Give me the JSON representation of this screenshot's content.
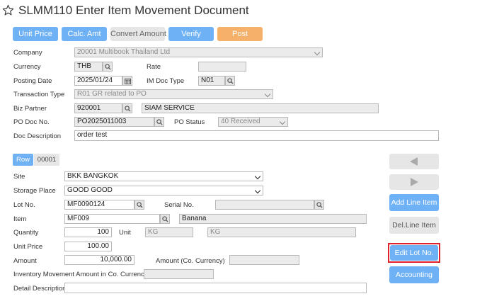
{
  "header": {
    "title": "SLMM110 Enter Item Movement Document"
  },
  "toolbar": {
    "unit_price": "Unit Price",
    "calc_amt": "Calc. Amt",
    "convert_amount": "Convert Amount",
    "verify": "Verify",
    "post": "Post"
  },
  "header_form": {
    "company_label": "Company",
    "company_value": "20001 Multibook Thailand Ltd",
    "currency_label": "Currency",
    "currency_value": "THB",
    "rate_label": "Rate",
    "rate_value": "",
    "posting_date_label": "Posting Date",
    "posting_date_value": "2025/01/24",
    "im_doc_type_label": "IM Doc Type",
    "im_doc_type_value": "N01",
    "transaction_type_label": "Transaction Type",
    "transaction_type_value": "R01 GR related to PO",
    "biz_partner_label": "Biz Partner",
    "biz_partner_code": "920001",
    "biz_partner_name": "SIAM SERVICE",
    "po_doc_no_label": "PO Doc No.",
    "po_doc_no_value": "PO2025011003",
    "po_status_label": "PO Status",
    "po_status_value": "40 Received",
    "doc_description_label": "Doc Description",
    "doc_description_value": "order test"
  },
  "row_tabs": {
    "row_label": "Row",
    "row_number": "00001"
  },
  "line_form": {
    "site_label": "Site",
    "site_value": "BKK BANGKOK",
    "storage_place_label": "Storage Place",
    "storage_place_value": "GOOD GOOD",
    "lot_no_label": "Lot No.",
    "lot_no_value": "MF0090124",
    "serial_no_label": "Serial No.",
    "serial_no_value": "",
    "item_label": "Item",
    "item_code": "MF009",
    "item_name": "Banana",
    "quantity_label": "Quantity",
    "quantity_value": "100",
    "unit_label": "Unit",
    "unit_code": "KG",
    "unit_name": "KG",
    "unit_price_label": "Unit Price",
    "unit_price_value": "100.00",
    "amount_label": "Amount",
    "amount_value": "10,000.00",
    "amount_co_label": "Amount (Co. Currency)",
    "amount_co_value": "",
    "inv_mvmt_label": "Inventory Movement Amount in Co. Currency",
    "inv_mvmt_value": "",
    "detail_desc_label": "Detail Description",
    "detail_desc_value": ""
  },
  "side_actions": {
    "add_line_item": "Add Line Item",
    "del_line_item": "Del.Line Item",
    "edit_lot_no": "Edit Lot No.",
    "accounting": "Accounting"
  },
  "colors": {
    "primary_blue": "#6fb1f5",
    "post_orange": "#f5b06a",
    "highlight_red": "#e0202a",
    "disabled_gray": "#e6e6e6"
  }
}
